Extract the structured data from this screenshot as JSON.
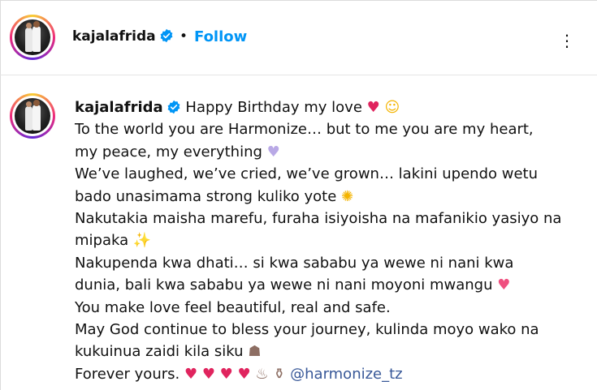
{
  "header": {
    "username": "kajalafrida",
    "separator": "•",
    "follow_label": "Follow",
    "more_label": "⋮"
  },
  "caption": {
    "username": "kajalafrida",
    "line1_text": "Happy Birthday my love",
    "line1_emoji_a": "♥",
    "line1_emoji_b": "☺",
    "line2": "To the world you are Harmonize… but to me you are my heart,",
    "line3_text": "my peace, my everything",
    "line3_emoji": "♥",
    "line4": "We’ve laughed, we’ve cried, we’ve grown… lakini upendo wetu",
    "line5_text": "bado unasimama strong kuliko yote",
    "line5_emoji": "✺",
    "line6": "Nakutakia maisha marefu, furaha isiyoisha na mafanikio yasiyo na",
    "line7_text": "mipaka",
    "line7_emoji": "✨",
    "line8": "Nakupenda kwa dhati… si kwa sababu ya wewe ni nani kwa",
    "line9_text": "dunia, bali kwa sababu ya wewe ni nani moyoni mwangu",
    "line9_emoji": "♥",
    "line10": "You make love feel beautiful, real and safe.",
    "line11": "May God continue to bless your journey, kulinda moyo wako na",
    "line12_text": "kukuinua zaidi kila siku",
    "line12_emoji": "☗",
    "line13_text": "Forever yours.",
    "line13_emojis": "♥ ♥ ♥ ♥",
    "line13_cake": "♨",
    "line13_bottle": "⚱",
    "mention": "@harmonize_tz"
  },
  "colors": {
    "accent_blue": "#0095f6",
    "mention_blue": "#385898",
    "heart_red": "#e0245e",
    "verified_blue": "#0095f6"
  },
  "icons": {
    "verified": "verified-badge-icon",
    "more": "more-options-icon"
  }
}
